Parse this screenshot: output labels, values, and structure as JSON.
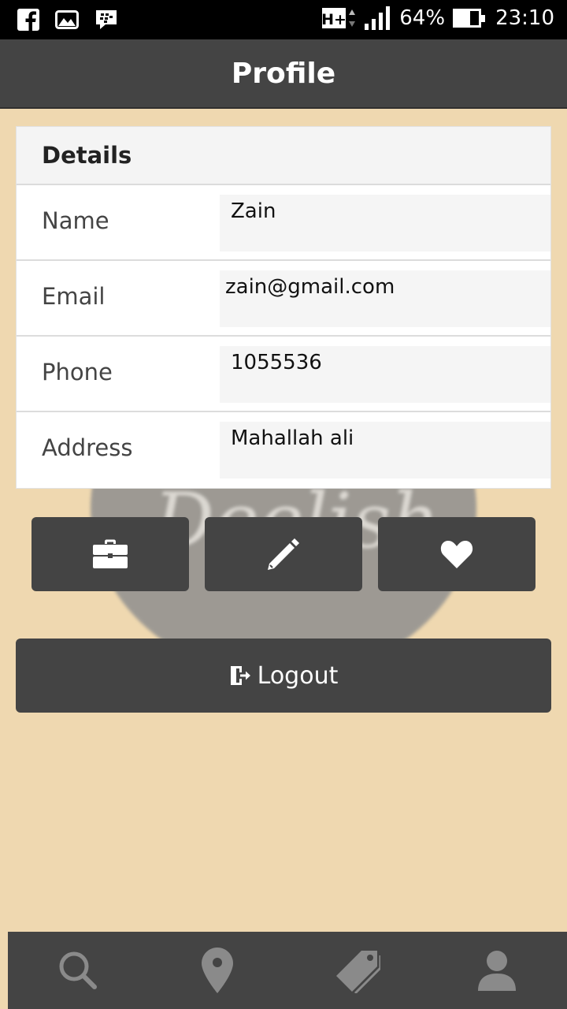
{
  "status_bar": {
    "left_icons": [
      "facebook-icon",
      "gallery-icon",
      "bbm-icon"
    ],
    "network": "H+",
    "battery_percent": "64%",
    "battery_level": 0.64,
    "time": "23:10"
  },
  "app_bar": {
    "title": "Profile"
  },
  "background": {
    "logo_text": "Deelish"
  },
  "details": {
    "header": "Details",
    "rows": [
      {
        "label": "Name",
        "value": "Zain"
      },
      {
        "label": "Email",
        "value": "zain@gmail.com"
      },
      {
        "label": "Phone",
        "value": "1055536"
      },
      {
        "label": "Address",
        "value": "Mahallah ali"
      }
    ]
  },
  "actions": [
    {
      "icon": "briefcase-icon"
    },
    {
      "icon": "pencil-icon"
    },
    {
      "icon": "heart-icon"
    }
  ],
  "logout": {
    "label": "Logout",
    "icon": "exit-door-icon"
  },
  "bottom_nav": [
    {
      "icon": "search-icon"
    },
    {
      "icon": "map-pin-icon"
    },
    {
      "icon": "tag-icon"
    },
    {
      "icon": "user-icon"
    }
  ],
  "colors": {
    "app_bar": "#444444",
    "page_background": "#efd8b0",
    "button": "#444444",
    "nav_icon": "#8a8a8a"
  }
}
